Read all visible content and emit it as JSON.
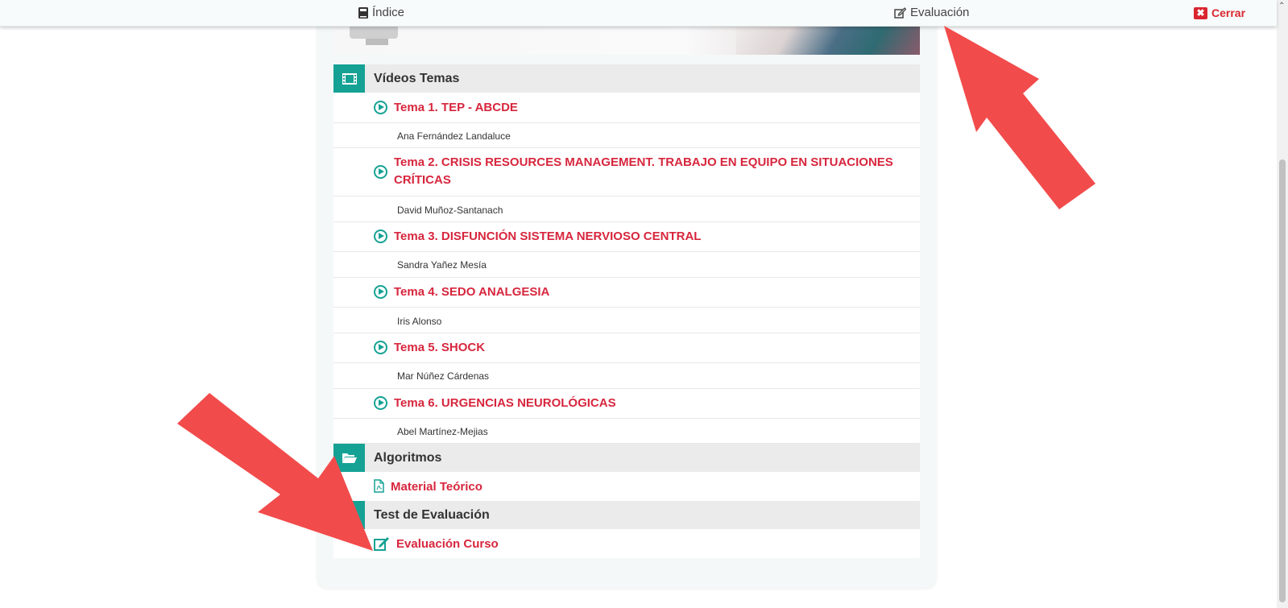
{
  "topbar": {
    "indice_label": "Índice",
    "evaluacion_label": "Evaluación",
    "cerrar_label": "Cerrar",
    "cerrar_icon": "✖"
  },
  "sections": {
    "videos": {
      "title": "Vídeos Temas"
    },
    "algoritmos": {
      "title": "Algoritmos"
    },
    "test": {
      "title": "Test de Evaluación"
    }
  },
  "topics": [
    {
      "title": "Tema 1. TEP - ABCDE",
      "author": "Ana Fernández Landaluce"
    },
    {
      "title": "Tema 2. CRISIS RESOURCES MANAGEMENT. TRABAJO EN EQUIPO EN SITUACIONES CRÍTICAS",
      "author": "David Muñoz-Santanach"
    },
    {
      "title": "Tema 3. DISFUNCIÓN SISTEMA NERVIOSO CENTRAL",
      "author": "Sandra Yañez Mesía"
    },
    {
      "title": "Tema 4. SEDO ANALGESIA",
      "author": "Iris Alonso"
    },
    {
      "title": "Tema 5. SHOCK",
      "author": "Mar Núñez Cárdenas"
    },
    {
      "title": "Tema 6. URGENCIAS NEUROLÓGICAS",
      "author": "Abel Martínez-Mejias"
    }
  ],
  "algoritmos": {
    "material_label": "Material Teórico"
  },
  "test": {
    "evaluacion_curso_label": "Evaluación Curso"
  },
  "colors": {
    "accent": "#15a294",
    "link": "#d7263d",
    "arrow": "#f24b4b"
  }
}
